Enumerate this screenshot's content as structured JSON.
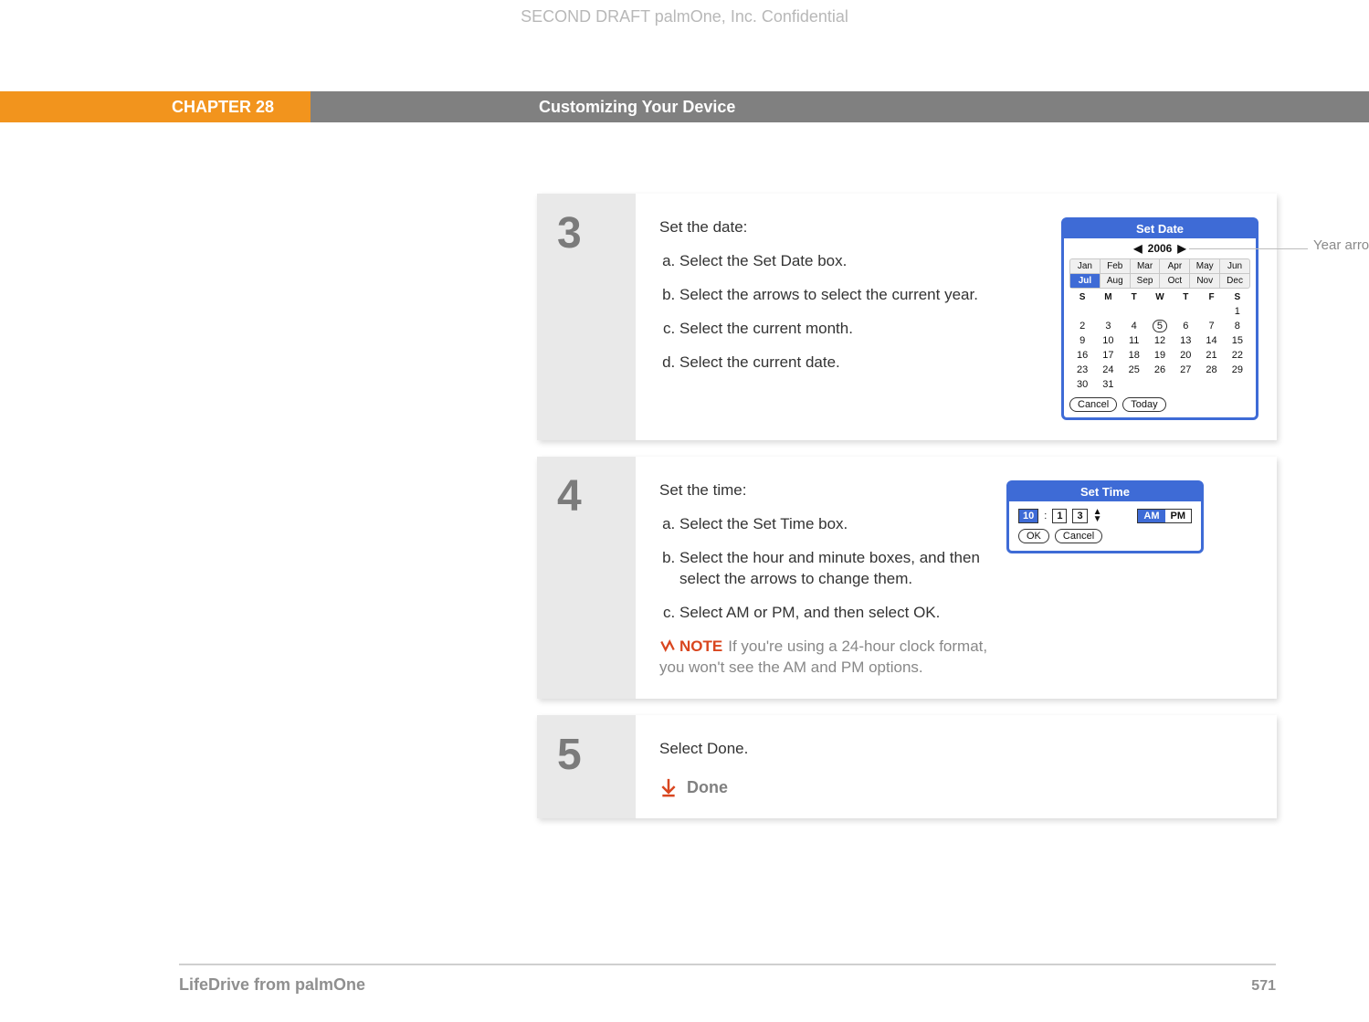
{
  "watermark": "SECOND DRAFT palmOne, Inc.  Confidential",
  "header": {
    "chapter": "CHAPTER 28",
    "title": "Customizing Your Device"
  },
  "steps": {
    "s3": {
      "num": "3",
      "heading": "Set the date:",
      "items": [
        "Select the Set Date box.",
        "Select the arrows to select the current year.",
        "Select the current month.",
        "Select the current date."
      ]
    },
    "s4": {
      "num": "4",
      "heading": "Set the time:",
      "items": [
        "Select the Set Time box.",
        "Select the hour and minute boxes, and then select the arrows to change them.",
        "Select AM or PM, and then select OK."
      ],
      "note_label": "NOTE",
      "note_text": "If you're using a 24-hour clock format, you won't see the AM and PM options."
    },
    "s5": {
      "num": "5",
      "heading": "Select Done.",
      "done_label": "Done"
    }
  },
  "set_date": {
    "title": "Set Date",
    "year": "2006",
    "months_row1": [
      "Jan",
      "Feb",
      "Mar",
      "Apr",
      "May",
      "Jun"
    ],
    "months_row2": [
      "Jul",
      "Aug",
      "Sep",
      "Oct",
      "Nov",
      "Dec"
    ],
    "selected_month": "Jul",
    "dows": [
      "S",
      "M",
      "T",
      "W",
      "T",
      "F",
      "S"
    ],
    "weeks": [
      [
        "",
        "",
        "",
        "",
        "",
        "",
        "1"
      ],
      [
        "2",
        "3",
        "4",
        "5",
        "6",
        "7",
        "8"
      ],
      [
        "9",
        "10",
        "11",
        "12",
        "13",
        "14",
        "15"
      ],
      [
        "16",
        "17",
        "18",
        "19",
        "20",
        "21",
        "22"
      ],
      [
        "23",
        "24",
        "25",
        "26",
        "27",
        "28",
        "29"
      ],
      [
        "30",
        "31",
        "",
        "",
        "",
        "",
        ""
      ]
    ],
    "today_cell": "5",
    "cancel": "Cancel",
    "today": "Today",
    "callout": "Year arrows"
  },
  "set_time": {
    "title": "Set Time",
    "hour": "10",
    "min1": "1",
    "min2": "3",
    "am": "AM",
    "pm": "PM",
    "ok": "OK",
    "cancel": "Cancel"
  },
  "footer": {
    "left": "LifeDrive from palmOne",
    "page": "571"
  }
}
